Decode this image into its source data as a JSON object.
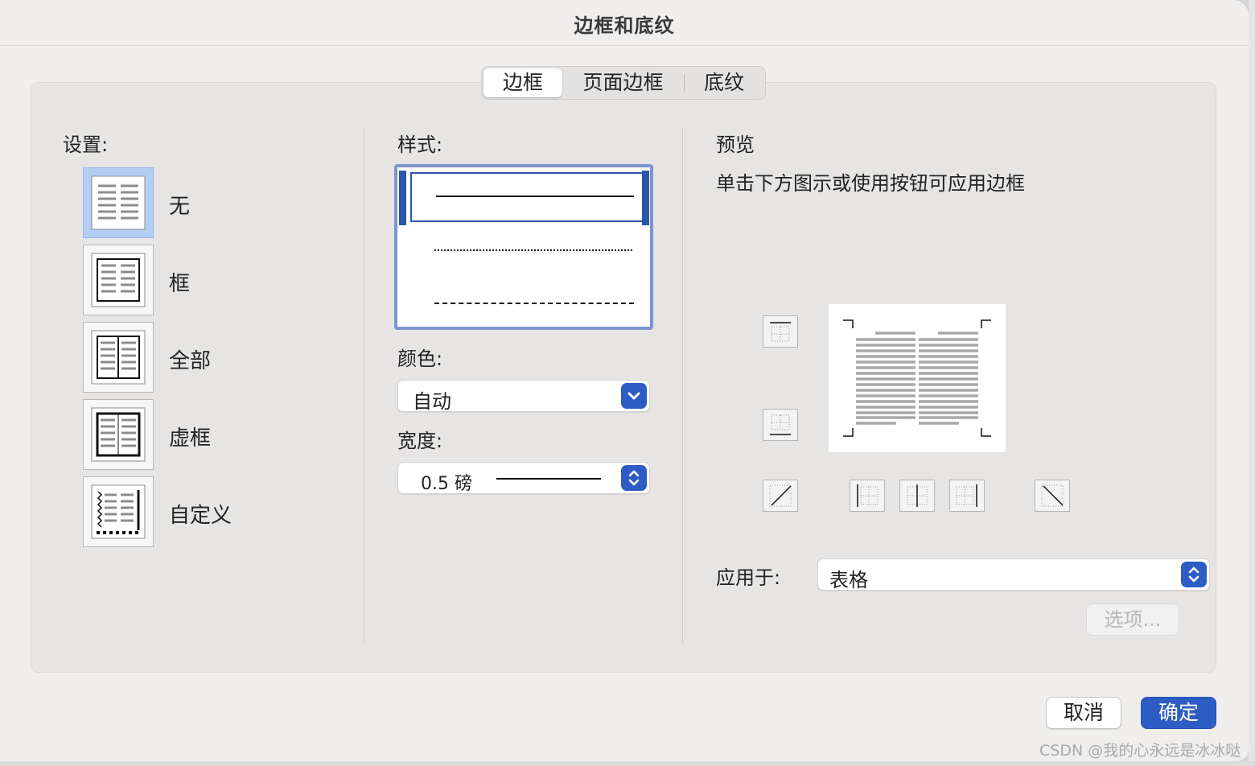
{
  "window": {
    "title": "边框和底纹"
  },
  "tabs": [
    {
      "label": "边框",
      "active": true
    },
    {
      "label": "页面边框",
      "active": false
    },
    {
      "label": "底纹",
      "active": false
    }
  ],
  "settings": {
    "label": "设置:",
    "items": [
      {
        "label": "无",
        "icon": "setting-none-icon",
        "selected": true
      },
      {
        "label": "框",
        "icon": "setting-box-icon",
        "selected": false
      },
      {
        "label": "全部",
        "icon": "setting-all-icon",
        "selected": false
      },
      {
        "label": "虚框",
        "icon": "setting-grid-icon",
        "selected": false
      },
      {
        "label": "自定义",
        "icon": "setting-custom-icon",
        "selected": false
      }
    ]
  },
  "style": {
    "label": "样式:",
    "options": [
      "solid",
      "dotted",
      "dashed"
    ],
    "selected": "solid"
  },
  "color": {
    "label": "颜色:",
    "value": "自动"
  },
  "width": {
    "label": "宽度:",
    "value": "0.5 磅"
  },
  "preview": {
    "label": "预览",
    "hint": "单击下方图示或使用按钮可应用边框",
    "buttons": [
      "top-border",
      "bottom-border",
      "diagonal-up",
      "left-border",
      "inside-vertical",
      "right-border",
      "diagonal-down"
    ]
  },
  "apply_to": {
    "label": "应用于:",
    "value": "表格"
  },
  "options_button": "选项...",
  "buttons": {
    "cancel": "取消",
    "ok": "确定"
  },
  "watermark": "CSDN @我的心永远是冰冰哒",
  "colors": {
    "accent": "#2d5cc4",
    "selected_setting": "#b4cdf3"
  }
}
